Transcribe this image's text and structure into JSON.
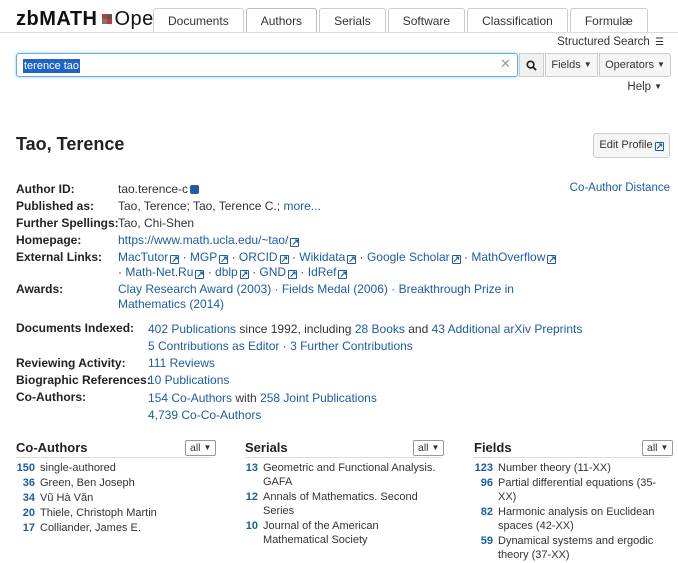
{
  "logo": {
    "zb": "zbMATH",
    "open": "Open"
  },
  "tabs": [
    {
      "label": "Documents"
    },
    {
      "label": "Authors"
    },
    {
      "label": "Serials"
    },
    {
      "label": "Software"
    },
    {
      "label": "Classification"
    },
    {
      "label": "Formulæ"
    }
  ],
  "structured_search": "Structured Search",
  "search": {
    "value": "terence tao",
    "fields_label": "Fields",
    "operators_label": "Operators"
  },
  "help": "Help",
  "profile": {
    "name": "Tao, Terence",
    "edit_label": "Edit Profile",
    "co_author_distance": "Co-Author Distance",
    "author_id_label": "Author ID:",
    "author_id": "tao.terence-c",
    "published_as_label": "Published as:",
    "published_as": "Tao, Terence; Tao, Terence C.;",
    "more": "more...",
    "further_spellings_label": "Further Spellings:",
    "further_spellings": "Tao, Chi-Shen",
    "homepage_label": "Homepage:",
    "homepage": "https://www.math.ucla.edu/~tao/",
    "external_links_label": "External Links:",
    "external_links": [
      "MacTutor",
      "MGP",
      "ORCID",
      "Wikidata",
      "Google Scholar",
      "MathOverflow",
      "Math-Net.Ru",
      "dblp",
      "GND",
      "IdRef"
    ],
    "awards_label": "Awards:",
    "awards_line1": "Clay Research Award (2003) · Fields Medal (2006) · Breakthrough Prize in",
    "awards_line2": "Mathematics (2014)"
  },
  "stats": {
    "documents_label": "Documents Indexed:",
    "publications": "402 Publications",
    "since": "since 1992, including",
    "books": "28 Books",
    "and": "and",
    "arxiv": "43 Additional arXiv Preprints",
    "editor": "5 Contributions as Editor",
    "further": "3 Further Contributions",
    "reviewing_label": "Reviewing Activity:",
    "reviews": "111 Reviews",
    "biographic_label": "Biographic References:",
    "biographic": "10 Publications",
    "coauthors_label": "Co-Authors:",
    "coauthors": "154 Co-Authors",
    "with": "with",
    "joint": "258 Joint Publications",
    "cocoauthors": "4,739 Co-Co-Authors"
  },
  "columns": {
    "all_label": "all",
    "coauthors": {
      "title": "Co-Authors",
      "items": [
        {
          "count": "150",
          "text": "single-authored"
        },
        {
          "count": "36",
          "text": "Green, Ben Joseph"
        },
        {
          "count": "34",
          "text": "Vũ Hà Văn"
        },
        {
          "count": "20",
          "text": "Thiele, Christoph Martin"
        },
        {
          "count": "17",
          "text": "Colliander, James E."
        }
      ]
    },
    "serials": {
      "title": "Serials",
      "items": [
        {
          "count": "13",
          "text": "Geometric and Functional Analysis. GAFA"
        },
        {
          "count": "12",
          "text": "Annals of Mathematics. Second Series"
        },
        {
          "count": "10",
          "text": "Journal of the American Mathematical Society"
        }
      ]
    },
    "fields": {
      "title": "Fields",
      "items": [
        {
          "count": "123",
          "text": "Number theory (11-XX)"
        },
        {
          "count": "96",
          "text": "Partial differential equations (35-XX)"
        },
        {
          "count": "82",
          "text": "Harmonic analysis on Euclidean spaces (42-XX)"
        },
        {
          "count": "59",
          "text": "Dynamical systems and ergodic theory (37-XX)"
        }
      ]
    }
  }
}
